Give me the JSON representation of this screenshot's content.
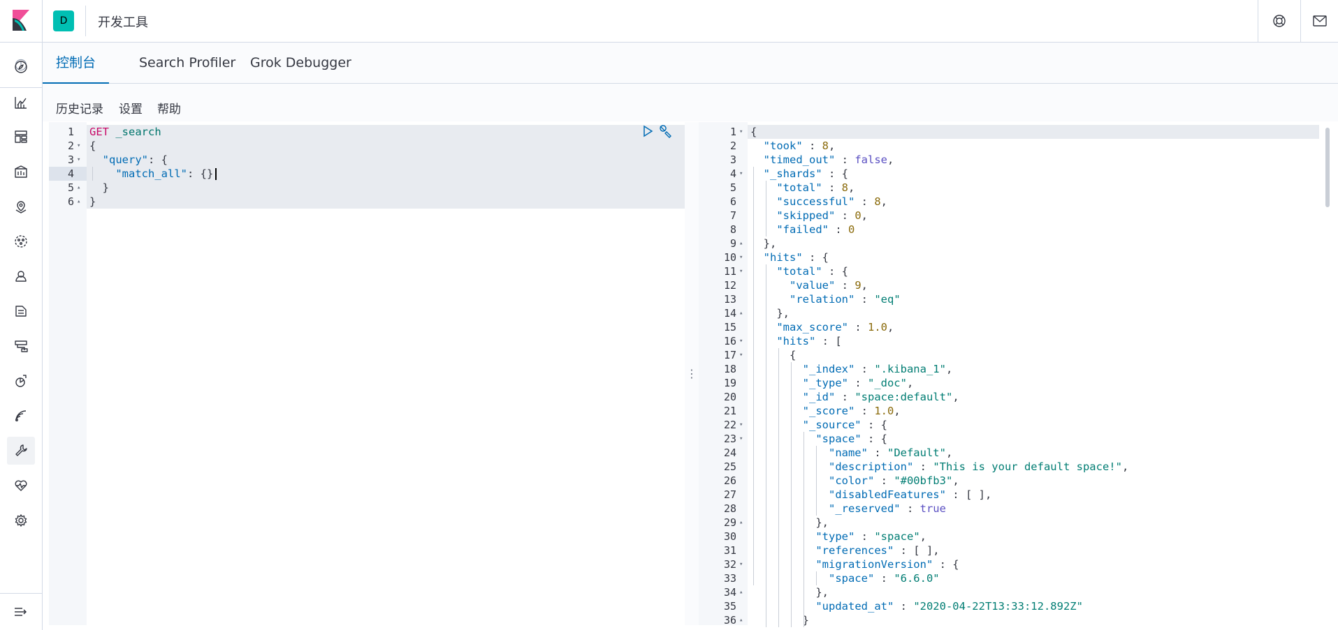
{
  "header": {
    "space_initial": "D",
    "app_title": "开发工具",
    "brand_color": "#00bfb3"
  },
  "nav": {
    "items": [
      {
        "name": "discover",
        "icon": "compass-icon"
      },
      {
        "name": "visualize",
        "icon": "chart-icon"
      },
      {
        "name": "dashboard",
        "icon": "dashboard-icon"
      },
      {
        "name": "canvas",
        "icon": "canvas-icon"
      },
      {
        "name": "maps",
        "icon": "map-pin-icon"
      },
      {
        "name": "ml",
        "icon": "ml-icon"
      },
      {
        "name": "siem",
        "icon": "shield-user-icon"
      },
      {
        "name": "logs",
        "icon": "logs-icon"
      },
      {
        "name": "infrastructure",
        "icon": "infra-icon"
      },
      {
        "name": "apm",
        "icon": "apm-icon"
      },
      {
        "name": "uptime",
        "icon": "uptime-icon"
      },
      {
        "name": "dev-tools",
        "icon": "wrench-icon"
      },
      {
        "name": "monitoring",
        "icon": "heartbeat-icon"
      },
      {
        "name": "management",
        "icon": "gear-icon"
      }
    ],
    "active": "dev-tools"
  },
  "tabs": [
    {
      "label": "控制台",
      "active": true
    },
    {
      "label": "Search Profiler",
      "active": false
    },
    {
      "label": "Grok Debugger",
      "active": false
    }
  ],
  "toolbar": {
    "history": "历史记录",
    "settings": "设置",
    "help": "帮助"
  },
  "request": {
    "lines": [
      {
        "n": "1",
        "fold": "",
        "tokens": [
          [
            "m",
            "GET"
          ],
          [
            "t",
            " "
          ],
          [
            "u",
            "_search"
          ]
        ]
      },
      {
        "n": "2",
        "fold": "▾",
        "tokens": [
          [
            "t",
            "{"
          ]
        ]
      },
      {
        "n": "3",
        "fold": "▾",
        "tokens": [
          [
            "t",
            "  "
          ],
          [
            "k",
            "\"query\""
          ],
          [
            "t",
            ": {"
          ]
        ]
      },
      {
        "n": "4",
        "fold": "",
        "tokens": [
          [
            "t",
            "    "
          ],
          [
            "k",
            "\"match_all\""
          ],
          [
            "t",
            ": {}"
          ]
        ]
      },
      {
        "n": "5",
        "fold": "▴",
        "tokens": [
          [
            "t",
            "  }"
          ]
        ]
      },
      {
        "n": "6",
        "fold": "▴",
        "tokens": [
          [
            "t",
            "}"
          ]
        ]
      }
    ]
  },
  "response": {
    "lines": [
      {
        "n": "1",
        "fold": "▾",
        "tokens": [
          [
            "t",
            "{"
          ]
        ]
      },
      {
        "n": "2",
        "fold": "",
        "tokens": [
          [
            "t",
            "  "
          ],
          [
            "k",
            "\"took\""
          ],
          [
            "t",
            " : "
          ],
          [
            "n",
            "8"
          ],
          [
            "t",
            ","
          ]
        ]
      },
      {
        "n": "3",
        "fold": "",
        "tokens": [
          [
            "t",
            "  "
          ],
          [
            "k",
            "\"timed_out\""
          ],
          [
            "t",
            " : "
          ],
          [
            "b",
            "false"
          ],
          [
            "t",
            ","
          ]
        ]
      },
      {
        "n": "4",
        "fold": "▾",
        "tokens": [
          [
            "t",
            "  "
          ],
          [
            "k",
            "\"_shards\""
          ],
          [
            "t",
            " : {"
          ]
        ]
      },
      {
        "n": "5",
        "fold": "",
        "tokens": [
          [
            "t",
            "    "
          ],
          [
            "k",
            "\"total\""
          ],
          [
            "t",
            " : "
          ],
          [
            "n",
            "8"
          ],
          [
            "t",
            ","
          ]
        ]
      },
      {
        "n": "6",
        "fold": "",
        "tokens": [
          [
            "t",
            "    "
          ],
          [
            "k",
            "\"successful\""
          ],
          [
            "t",
            " : "
          ],
          [
            "n",
            "8"
          ],
          [
            "t",
            ","
          ]
        ]
      },
      {
        "n": "7",
        "fold": "",
        "tokens": [
          [
            "t",
            "    "
          ],
          [
            "k",
            "\"skipped\""
          ],
          [
            "t",
            " : "
          ],
          [
            "n",
            "0"
          ],
          [
            "t",
            ","
          ]
        ]
      },
      {
        "n": "8",
        "fold": "",
        "tokens": [
          [
            "t",
            "    "
          ],
          [
            "k",
            "\"failed\""
          ],
          [
            "t",
            " : "
          ],
          [
            "n",
            "0"
          ]
        ]
      },
      {
        "n": "9",
        "fold": "▴",
        "tokens": [
          [
            "t",
            "  },"
          ]
        ]
      },
      {
        "n": "10",
        "fold": "▾",
        "tokens": [
          [
            "t",
            "  "
          ],
          [
            "k",
            "\"hits\""
          ],
          [
            "t",
            " : {"
          ]
        ]
      },
      {
        "n": "11",
        "fold": "▾",
        "tokens": [
          [
            "t",
            "    "
          ],
          [
            "k",
            "\"total\""
          ],
          [
            "t",
            " : {"
          ]
        ]
      },
      {
        "n": "12",
        "fold": "",
        "tokens": [
          [
            "t",
            "      "
          ],
          [
            "k",
            "\"value\""
          ],
          [
            "t",
            " : "
          ],
          [
            "n",
            "9"
          ],
          [
            "t",
            ","
          ]
        ]
      },
      {
        "n": "13",
        "fold": "",
        "tokens": [
          [
            "t",
            "      "
          ],
          [
            "k",
            "\"relation\""
          ],
          [
            "t",
            " : "
          ],
          [
            "s",
            "\"eq\""
          ]
        ]
      },
      {
        "n": "14",
        "fold": "▴",
        "tokens": [
          [
            "t",
            "    },"
          ]
        ]
      },
      {
        "n": "15",
        "fold": "",
        "tokens": [
          [
            "t",
            "    "
          ],
          [
            "k",
            "\"max_score\""
          ],
          [
            "t",
            " : "
          ],
          [
            "n",
            "1.0"
          ],
          [
            "t",
            ","
          ]
        ]
      },
      {
        "n": "16",
        "fold": "▾",
        "tokens": [
          [
            "t",
            "    "
          ],
          [
            "k",
            "\"hits\""
          ],
          [
            "t",
            " : ["
          ]
        ]
      },
      {
        "n": "17",
        "fold": "▾",
        "tokens": [
          [
            "t",
            "      {"
          ]
        ]
      },
      {
        "n": "18",
        "fold": "",
        "tokens": [
          [
            "t",
            "        "
          ],
          [
            "k",
            "\"_index\""
          ],
          [
            "t",
            " : "
          ],
          [
            "s",
            "\".kibana_1\""
          ],
          [
            "t",
            ","
          ]
        ]
      },
      {
        "n": "19",
        "fold": "",
        "tokens": [
          [
            "t",
            "        "
          ],
          [
            "k",
            "\"_type\""
          ],
          [
            "t",
            " : "
          ],
          [
            "s",
            "\"_doc\""
          ],
          [
            "t",
            ","
          ]
        ]
      },
      {
        "n": "20",
        "fold": "",
        "tokens": [
          [
            "t",
            "        "
          ],
          [
            "k",
            "\"_id\""
          ],
          [
            "t",
            " : "
          ],
          [
            "s",
            "\"space:default\""
          ],
          [
            "t",
            ","
          ]
        ]
      },
      {
        "n": "21",
        "fold": "",
        "tokens": [
          [
            "t",
            "        "
          ],
          [
            "k",
            "\"_score\""
          ],
          [
            "t",
            " : "
          ],
          [
            "n",
            "1.0"
          ],
          [
            "t",
            ","
          ]
        ]
      },
      {
        "n": "22",
        "fold": "▾",
        "tokens": [
          [
            "t",
            "        "
          ],
          [
            "k",
            "\"_source\""
          ],
          [
            "t",
            " : {"
          ]
        ]
      },
      {
        "n": "23",
        "fold": "▾",
        "tokens": [
          [
            "t",
            "          "
          ],
          [
            "k",
            "\"space\""
          ],
          [
            "t",
            " : {"
          ]
        ]
      },
      {
        "n": "24",
        "fold": "",
        "tokens": [
          [
            "t",
            "            "
          ],
          [
            "k",
            "\"name\""
          ],
          [
            "t",
            " : "
          ],
          [
            "s",
            "\"Default\""
          ],
          [
            "t",
            ","
          ]
        ]
      },
      {
        "n": "25",
        "fold": "",
        "tokens": [
          [
            "t",
            "            "
          ],
          [
            "k",
            "\"description\""
          ],
          [
            "t",
            " : "
          ],
          [
            "s",
            "\"This is your default space!\""
          ],
          [
            "t",
            ","
          ]
        ]
      },
      {
        "n": "26",
        "fold": "",
        "tokens": [
          [
            "t",
            "            "
          ],
          [
            "k",
            "\"color\""
          ],
          [
            "t",
            " : "
          ],
          [
            "s",
            "\"#00bfb3\""
          ],
          [
            "t",
            ","
          ]
        ]
      },
      {
        "n": "27",
        "fold": "",
        "tokens": [
          [
            "t",
            "            "
          ],
          [
            "k",
            "\"disabledFeatures\""
          ],
          [
            "t",
            " : [ ],"
          ]
        ]
      },
      {
        "n": "28",
        "fold": "",
        "tokens": [
          [
            "t",
            "            "
          ],
          [
            "k",
            "\"_reserved\""
          ],
          [
            "t",
            " : "
          ],
          [
            "b",
            "true"
          ]
        ]
      },
      {
        "n": "29",
        "fold": "▴",
        "tokens": [
          [
            "t",
            "          },"
          ]
        ]
      },
      {
        "n": "30",
        "fold": "",
        "tokens": [
          [
            "t",
            "          "
          ],
          [
            "k",
            "\"type\""
          ],
          [
            "t",
            " : "
          ],
          [
            "s",
            "\"space\""
          ],
          [
            "t",
            ","
          ]
        ]
      },
      {
        "n": "31",
        "fold": "",
        "tokens": [
          [
            "t",
            "          "
          ],
          [
            "k",
            "\"references\""
          ],
          [
            "t",
            " : [ ],"
          ]
        ]
      },
      {
        "n": "32",
        "fold": "▾",
        "tokens": [
          [
            "t",
            "          "
          ],
          [
            "k",
            "\"migrationVersion\""
          ],
          [
            "t",
            " : {"
          ]
        ]
      },
      {
        "n": "33",
        "fold": "",
        "tokens": [
          [
            "t",
            "            "
          ],
          [
            "k",
            "\"space\""
          ],
          [
            "t",
            " : "
          ],
          [
            "s",
            "\"6.6.0\""
          ]
        ]
      },
      {
        "n": "34",
        "fold": "▴",
        "tokens": [
          [
            "t",
            "          },"
          ]
        ]
      },
      {
        "n": "35",
        "fold": "",
        "tokens": [
          [
            "t",
            "          "
          ],
          [
            "k",
            "\"updated_at\""
          ],
          [
            "t",
            " : "
          ],
          [
            "s",
            "\"2020-04-22T13:33:12.892Z\""
          ]
        ]
      },
      {
        "n": "36",
        "fold": "▴",
        "tokens": [
          [
            "t",
            "        }"
          ]
        ]
      }
    ]
  }
}
